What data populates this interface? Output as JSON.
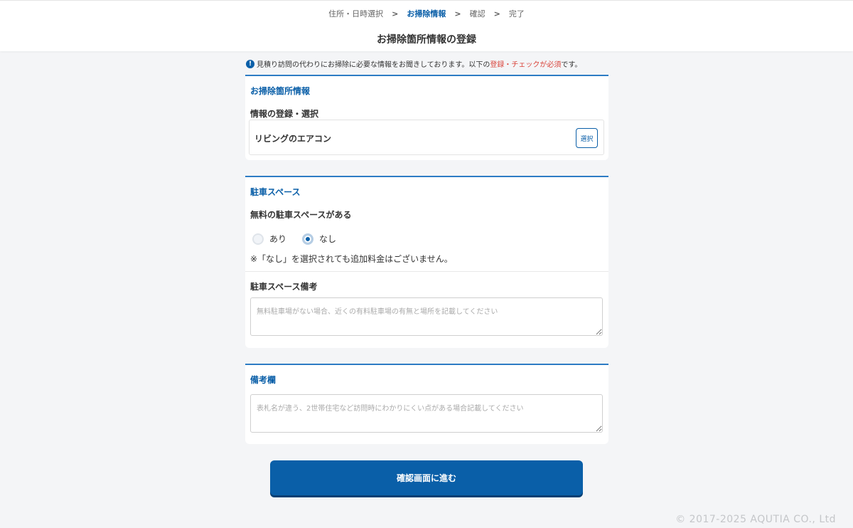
{
  "steps": [
    {
      "label": "住所・日時選択",
      "active": false
    },
    {
      "label": "お掃除情報",
      "active": true
    },
    {
      "label": "確認",
      "active": false
    },
    {
      "label": "完了",
      "active": false
    }
  ],
  "step_separator": ">",
  "page_title": "お掃除箇所情報の登録",
  "notice": {
    "icon": "info-icon",
    "text_before": "見積り訪問の代わりにお掃除に必要な情報をお聞きしております。以下の",
    "text_highlight": "登録・チェックが必須",
    "text_after": "です。",
    "highlight_color": "#d9433a"
  },
  "cleaning_card": {
    "title": "お掃除箇所情報",
    "field_label": "情報の登録・選択",
    "selected_value": "リビングのエアコン",
    "select_button": "選択"
  },
  "parking_card": {
    "title": "駐車スペース",
    "question": "無料の駐車スペースがある",
    "options": [
      {
        "label": "あり",
        "selected": false
      },
      {
        "label": "なし",
        "selected": true
      }
    ],
    "note": "※「なし」を選択されても追加料金はございません。",
    "remarks_label": "駐車スペース備考",
    "remarks_placeholder": "無料駐車場がない場合、近くの有料駐車場の有無と場所を記載してください",
    "remarks_value": ""
  },
  "remarks_card": {
    "title": "備考欄",
    "placeholder": "表札名が違う、2世帯住宅など訪問時にわかりにくい点がある場合記載してください",
    "value": ""
  },
  "submit_label": "確認画面に進む",
  "copyright": "© 2017-2025 AQUTIA CO., Ltd",
  "colors": {
    "primary": "#0a5fa8",
    "background": "#f4f5f7",
    "card_border": "#2d7cc4"
  }
}
